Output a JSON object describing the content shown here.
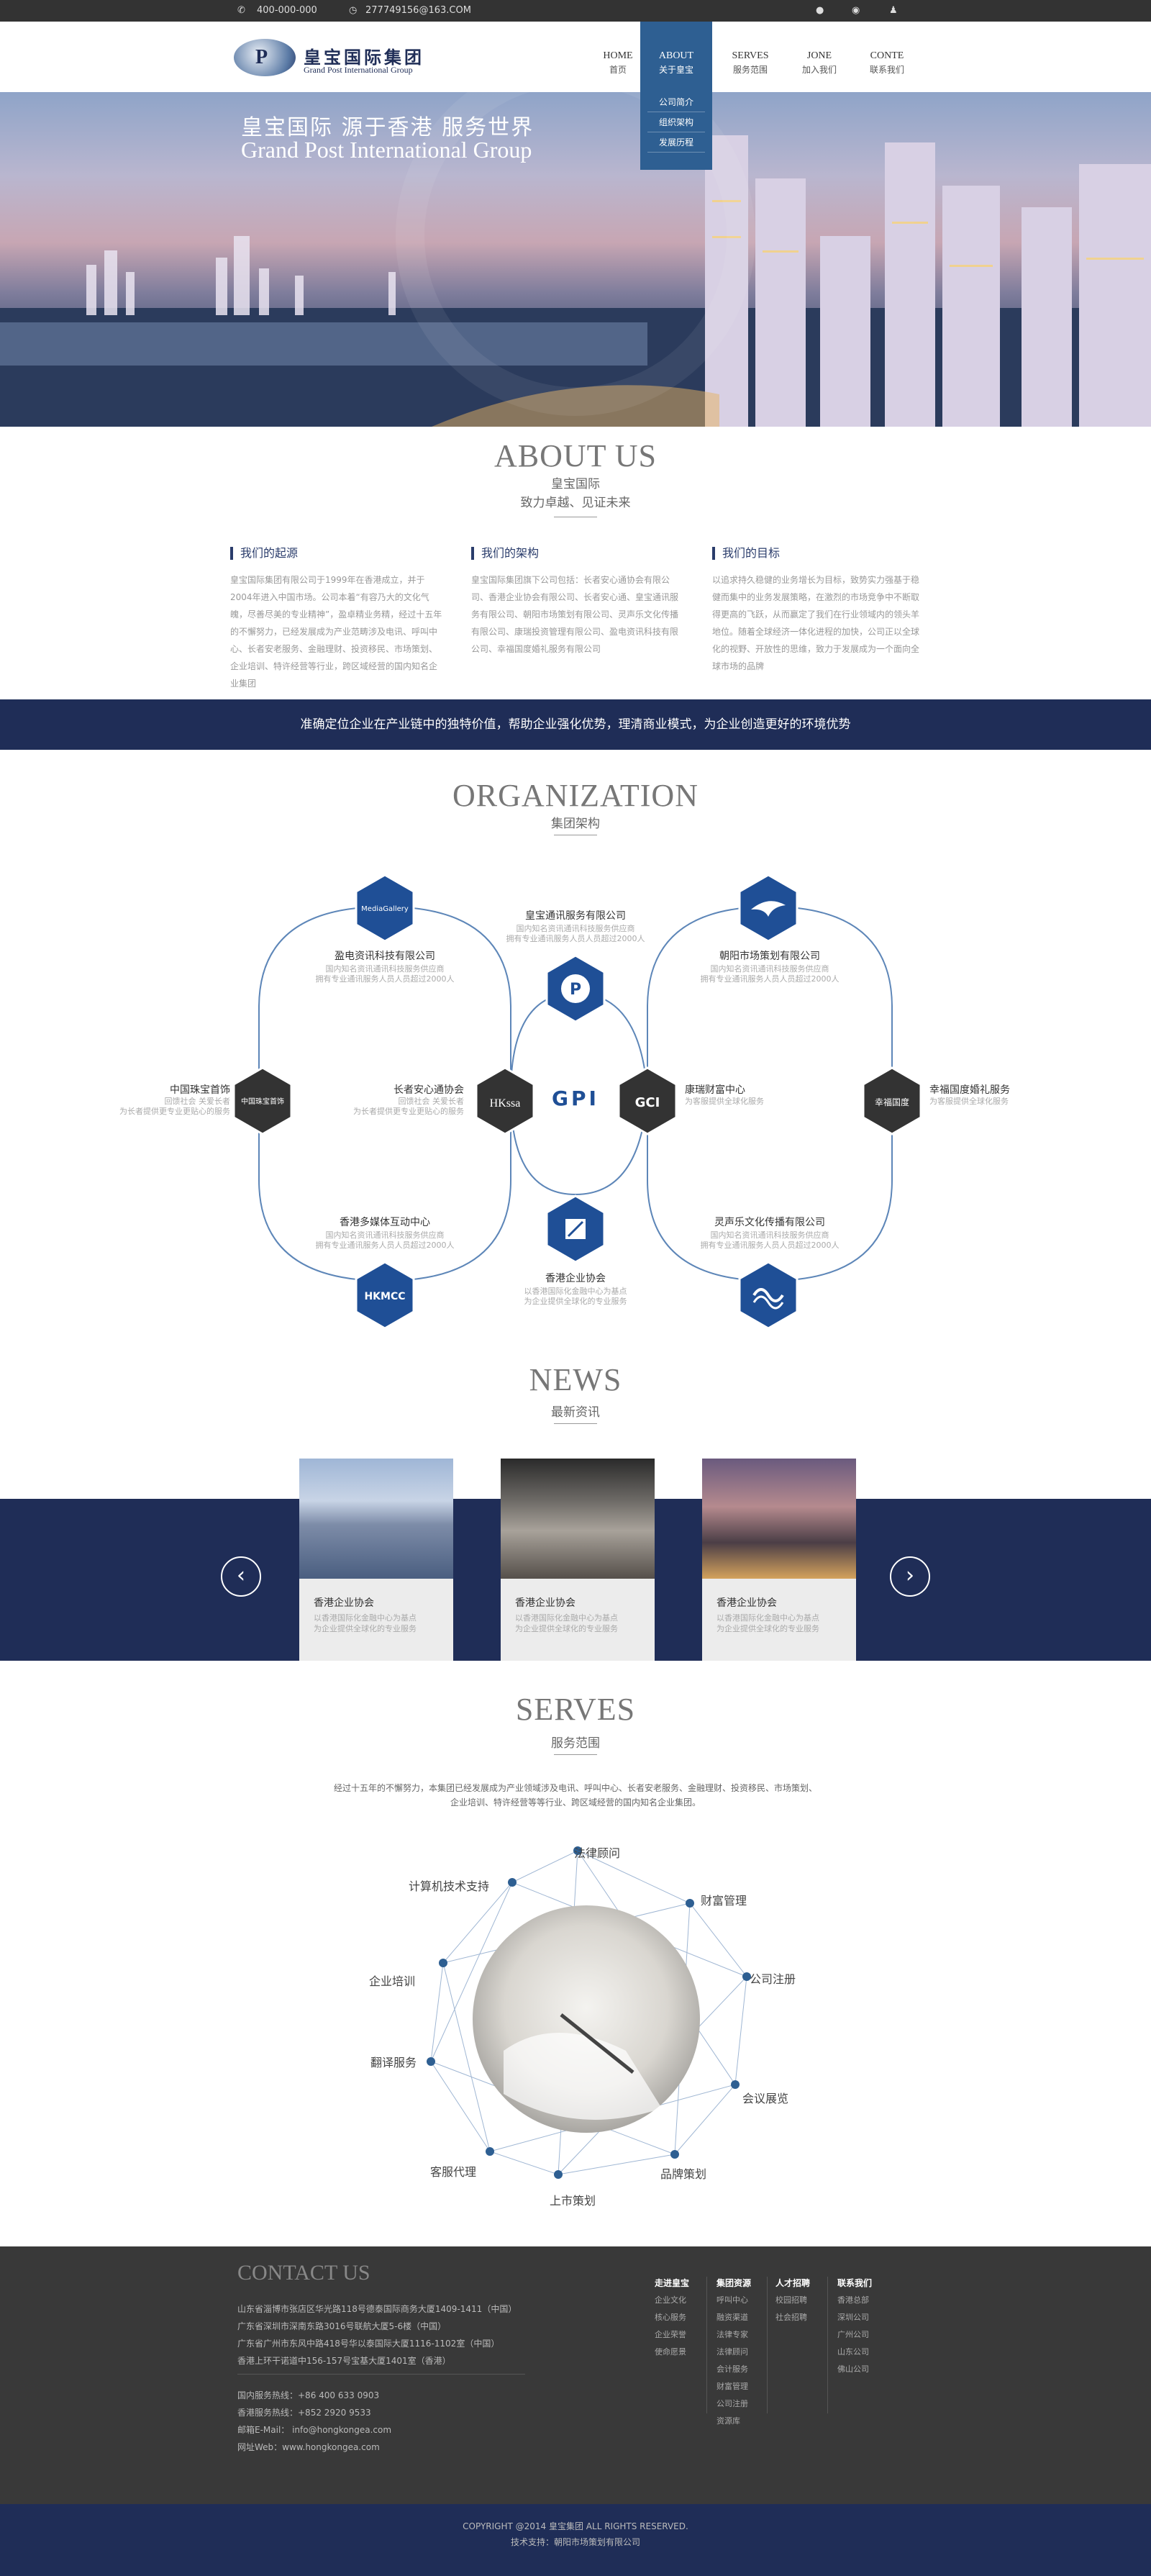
{
  "topbar": {
    "phone": "400-000-000",
    "email": "277749156@163.COM"
  },
  "header": {
    "logo_cn": "皇宝国际集团",
    "logo_en": "Grand Post International Group",
    "nav": [
      {
        "en": "HOME",
        "cn": "首页"
      },
      {
        "en": "ABOUT",
        "cn": "关于皇宝"
      },
      {
        "en": "SERVES",
        "cn": "服务范围"
      },
      {
        "en": "JONE",
        "cn": "加入我们"
      },
      {
        "en": "CONTE",
        "cn": "联系我们"
      }
    ],
    "subnav": [
      "公司简介",
      "组织架构",
      "发展历程"
    ]
  },
  "banner": {
    "line1": "皇宝国际   源于香港   服务世界",
    "line2": "Grand Post International Group"
  },
  "about": {
    "title_en": "ABOUT US",
    "title_cn": "皇宝国际",
    "subtitle": "致力卓越、见证未来",
    "cols": [
      {
        "title": "我们的起源",
        "text": "皇宝国际集团有限公司于1999年在香港成立，并于2004年进入中国市场。公司本着“有容乃大的文化气魄，尽善尽美的专业精神”，盈卓精业务精，经过十五年的不懈努力，已经发展成为产业范畴涉及电讯、呼叫中心、长者安老服务、金融理财、投资移民、市场策划、企业培训、特许经营等行业，跨区域经营的国内知名企业集团"
      },
      {
        "title": "我们的架构",
        "text": "皇宝国际集团旗下公司包括：长者安心通协会有限公司、香港企业协会有限公司、长者安心通、皇宝通讯服务有限公司、朝阳市场策划有限公司、灵声乐文化传播有限公司、康瑞投资管理有限公司、盈电资讯科技有限公司、幸福国度婚礼服务有限公司"
      },
      {
        "title": "我们的目标",
        "text": "以追求持久稳健的业务增长为目标，致势实力强基于稳健而集中的业务发展策略，在激烈的市场竞争中不断取得更高的飞跃，从而赢定了我们在行业领域内的领头羊地位。随着全球经济一体化进程的加快，公司正以全球化的视野、开放性的思维，致力于发展成为一个面向全球市场的品牌"
      }
    ]
  },
  "slogan": "准确定位企业在产业链中的独特价值，帮助企业强化优势，理清商业模式，为企业创造更好的环境优势",
  "org": {
    "title_en": "ORGANIZATION",
    "title_cn": "集团架构",
    "center_text": "GPI",
    "nodes": [
      {
        "name": "皇宝通讯服务有限公司",
        "desc": "国内知名资讯通讯科技服务供应商\n拥有专业通讯服务人员人员超过2000人"
      },
      {
        "name": "盈电资讯科技有限公司",
        "desc": "国内知名资讯通讯科技服务供应商\n拥有专业通讯服务人员人员超过2000人"
      },
      {
        "name": "朝阳市场策划有限公司",
        "desc": "国内知名资讯通讯科技服务供应商\n拥有专业通讯服务人员人员超过2000人"
      },
      {
        "name": "中国珠宝首饰",
        "desc": "回馈社会 关爱长者\n为长者提供更专业更贴心的服务"
      },
      {
        "name": "长者安心通协会",
        "desc": "回馈社会 关爱长者\n为长者提供更专业更贴心的服务"
      },
      {
        "name": "康瑞财富中心",
        "desc": "为客服提供全球化服务"
      },
      {
        "name": "幸福国度婚礼服务",
        "desc": "为客服提供全球化服务"
      },
      {
        "name": "香港多媒体互动中心",
        "desc": "国内知名资讯通讯科技服务供应商\n拥有专业通讯服务人员人员超过2000人"
      },
      {
        "name": "灵声乐文化传播有限公司",
        "desc": "国内知名资讯通讯科技服务供应商\n拥有专业通讯服务人员人员超过2000人"
      },
      {
        "name": "香港企业协会",
        "desc": "以香港国际化金融中心为基点\n为企业提供全球化的专业服务"
      }
    ],
    "hex_labels": {
      "hkssa": "HKssa",
      "gci": "GCI",
      "jewel": "中国珠宝首饰",
      "happy": "幸福国度",
      "hkmcc": "HKMCC",
      "gallery": "MediaGallery"
    }
  },
  "news": {
    "title_en": "NEWS",
    "title_cn": "最新资讯",
    "cards": [
      {
        "title": "香港企业协会",
        "desc": "以香港国际化金融中心为基点\n为企业提供全球化的专业服务"
      },
      {
        "title": "香港企业协会",
        "desc": "以香港国际化金融中心为基点\n为企业提供全球化的专业服务"
      },
      {
        "title": "香港企业协会",
        "desc": "以香港国际化金融中心为基点\n为企业提供全球化的专业服务"
      }
    ],
    "prev": "‹",
    "next": "›"
  },
  "serves": {
    "title_en": "SERVES",
    "title_cn": "服务范围",
    "intro1": "经过十五年的不懈努力，本集团已经发展成为产业领域涉及电讯、呼叫中心、长者安老服务、金融理财、投资移民、市场策划、",
    "intro2": "企业培训、特许经营等等行业、跨区域经营的国内知名企业集团。",
    "items": [
      "法律顾问",
      "财富管理",
      "公司注册",
      "会议展览",
      "品牌策划",
      "上市策划",
      "客服代理",
      "翻译服务",
      "企业培训",
      "计算机技术支持"
    ]
  },
  "contact": {
    "title": "CONTACT US",
    "addresses": [
      "山东省淄博市张店区华光路118号德泰国际商务大厦1409-1411（中国）",
      "广东省深圳市深南东路3016号联航大厦5-6楼（中国）",
      "广东省广州市东风中路418号华以泰国际大厦1116-1102室（中国）",
      "香港上环干诺道中156-157号宝基大厦1401室（香港）"
    ],
    "hotline_cn": "国内服务热线：+86 400 633 0903",
    "hotline_hk": "香港服务热线：+852 2920 9533",
    "email": "邮箱E-Mail：  info@hongkongea.com",
    "web": "网址Web：www.hongkongea.com",
    "cols": [
      {
        "title": "走进皇宝",
        "items": [
          "企业文化",
          "核心服务",
          "企业荣誉",
          "使命愿景"
        ]
      },
      {
        "title": "集团资源",
        "items": [
          "呼叫中心",
          "融资渠道",
          "法律专家",
          "法律顾问",
          "会计服务",
          "财富管理",
          "公司注册",
          "资源库"
        ]
      },
      {
        "title": "人才招聘",
        "items": [
          "校园招聘",
          "社会招聘"
        ]
      },
      {
        "title": "联系我们",
        "items": [
          "香港总部",
          "深圳公司",
          "广州公司",
          "山东公司",
          "佛山公司"
        ]
      }
    ]
  },
  "footer": {
    "copyright": "COPYRIGHT @2014 皇宝集团  ALL RIGHTS RESERVED.",
    "support": "技术支持：朝阳市场策划有限公司"
  },
  "colors": {
    "navy": "#1f2d57",
    "blue": "#2e5f92",
    "dark": "#393939"
  }
}
